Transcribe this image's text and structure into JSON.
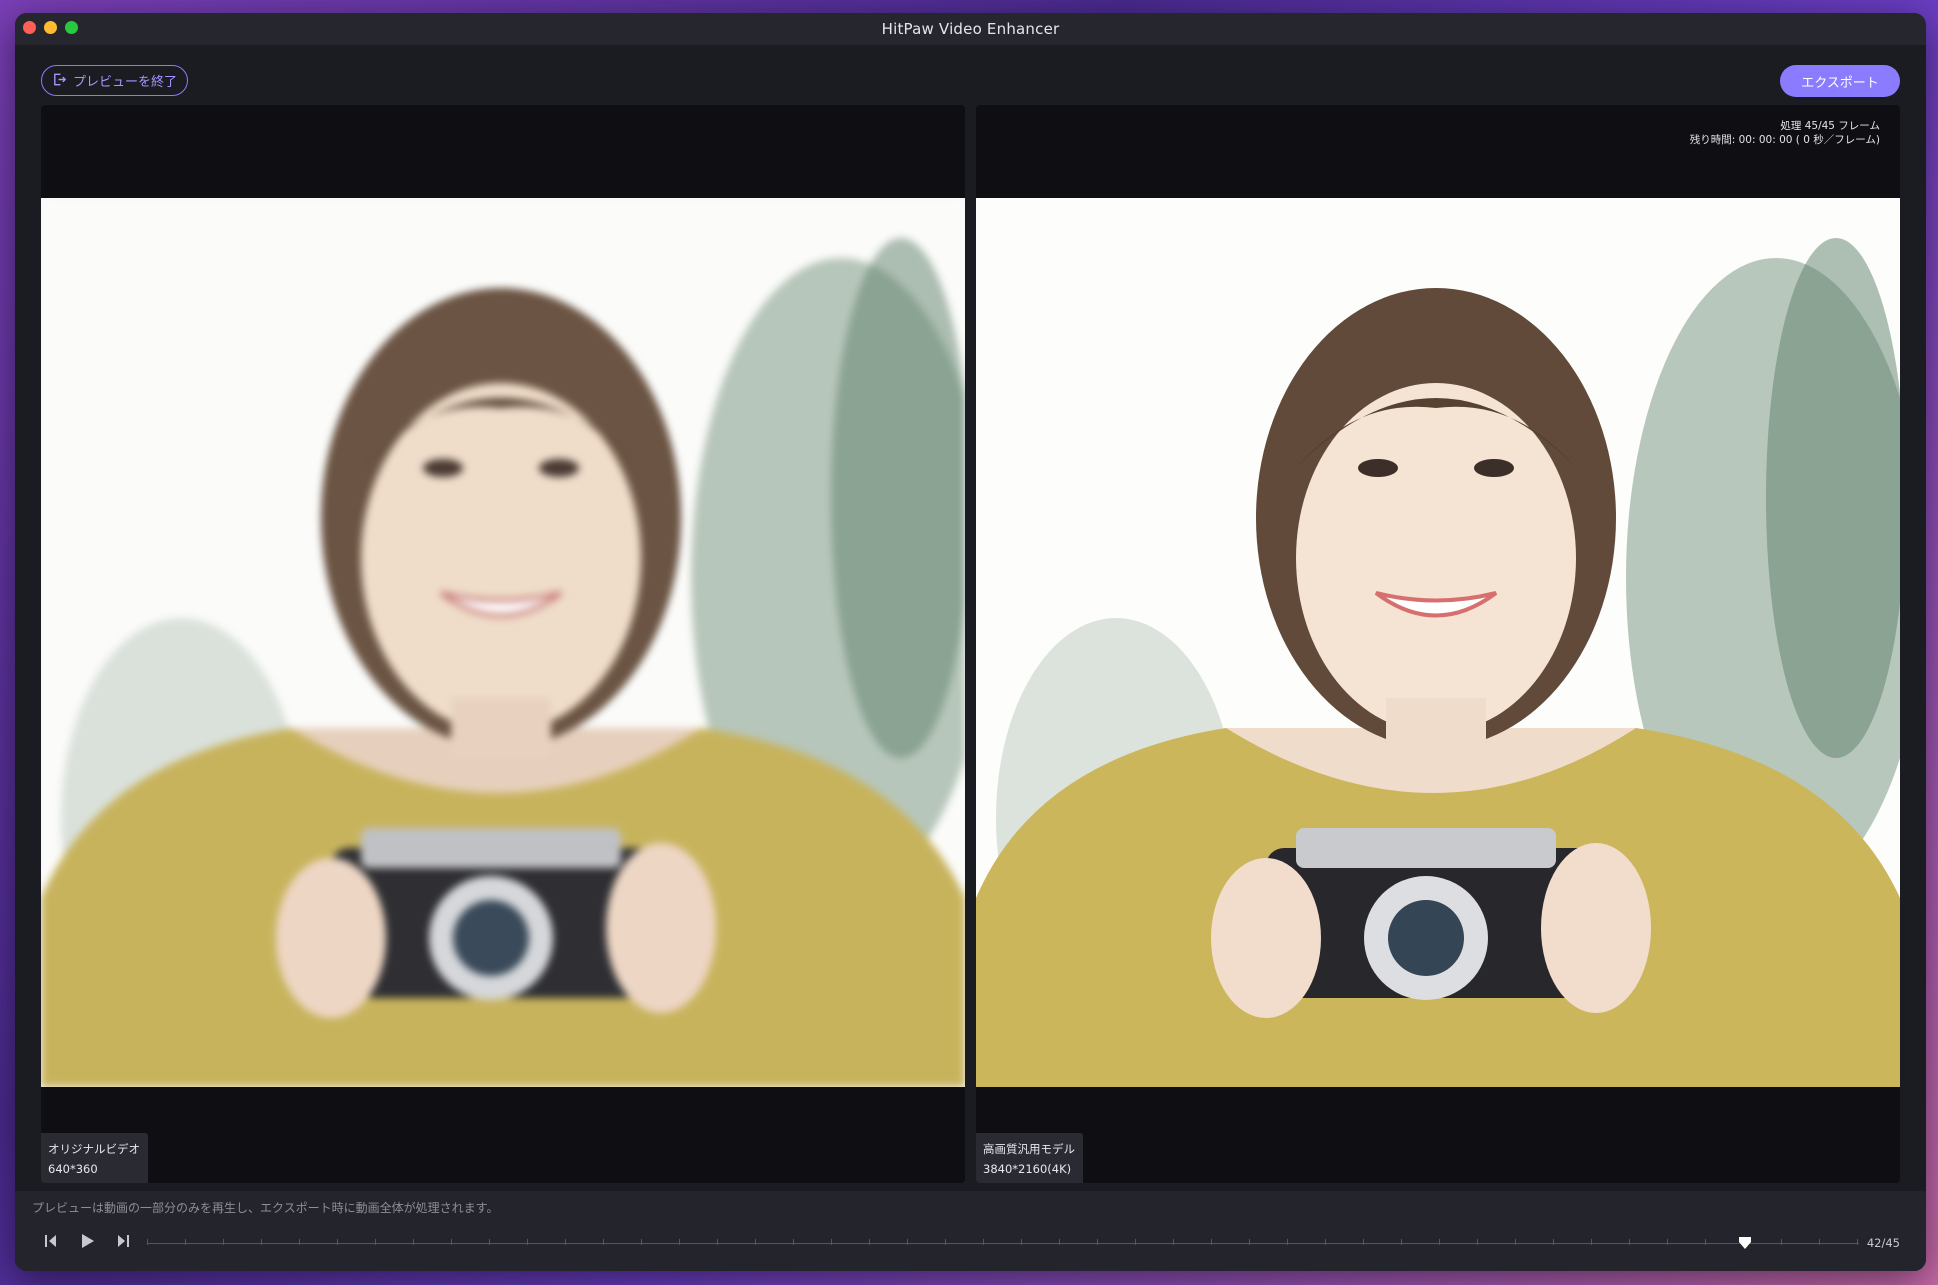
{
  "window": {
    "title": "HitPaw Video Enhancer"
  },
  "toolbar": {
    "exit_label": "プレビューを終了",
    "export_label": "エクスポート"
  },
  "left_pane": {
    "label": "オリジナルビデオ",
    "resolution": "640*360"
  },
  "right_pane": {
    "label": "高画質汎用モデル",
    "resolution": "3840*2160(4K)",
    "stats_line1": "処理 45/45 フレーム",
    "stats_line2": "残り時間: 00: 00: 00 ( 0 秒／フレーム)"
  },
  "bottom": {
    "hint": "プレビューは動画の一部分のみを再生し、エクスポート時に動画全体が処理されます。",
    "frame_counter": "42/45",
    "current_frame": 42,
    "total_frames": 45
  },
  "icons": [
    "exit-icon",
    "prev-frame-icon",
    "play-icon",
    "next-frame-icon",
    "playhead-icon"
  ],
  "colors": {
    "accent": "#8b7cff",
    "window_bg": "#1b1b22",
    "pane_bg": "#0f0f13"
  }
}
